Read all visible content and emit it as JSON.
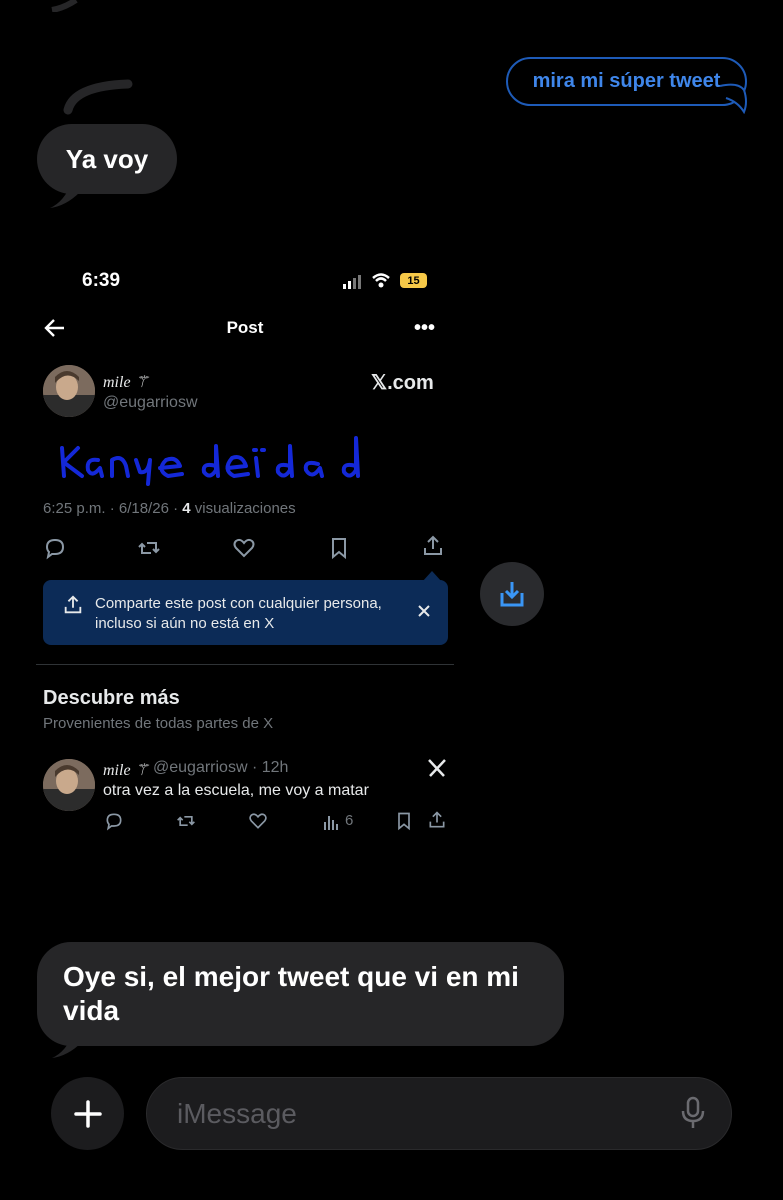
{
  "messages": {
    "outgoing_1": "mira mi súper tweet",
    "incoming_1": "Ya voy",
    "incoming_2": "Oye si, el mejor tweet que vi en mi vida"
  },
  "embedded": {
    "status": {
      "time": "6:39",
      "battery": "15"
    },
    "header": {
      "title": "Post"
    },
    "post": {
      "author_name": "mile ⚚",
      "author_handle": "@eugarriosw",
      "source": "𝕏.com",
      "handwriting": "Kanye deïdad",
      "timestamp": "6:25 p.m. · 6/18/26 · ",
      "views_count": "4",
      "views_label": " visualizaciones"
    },
    "share_banner": {
      "text": "Comparte este post con cualquier persona, incluso si aún no está en X"
    },
    "discover": {
      "title": "Descubre más",
      "subtitle": "Provenientes de todas partes de X",
      "tweet": {
        "author_name": "mile ⚚",
        "meta": "@eugarriosw · 12h",
        "text": "otra vez a la escuela, me voy a matar",
        "views": "6"
      }
    }
  },
  "input": {
    "placeholder": "iMessage"
  },
  "colors": {
    "background": "#000000",
    "bubble_incoming": "#262628",
    "bubble_outgoing_border": "#1e5bb8",
    "bubble_outgoing_text": "#3f86ea",
    "banner_bg": "#0c2b57",
    "handwriting_blue": "#1428d8"
  },
  "icons": [
    "back-arrow-icon",
    "more-icon",
    "reply-icon",
    "retweet-icon",
    "like-icon",
    "bookmark-icon",
    "share-icon",
    "close-icon",
    "download-icon",
    "x-logo-icon",
    "views-icon",
    "plus-icon",
    "microphone-icon"
  ]
}
